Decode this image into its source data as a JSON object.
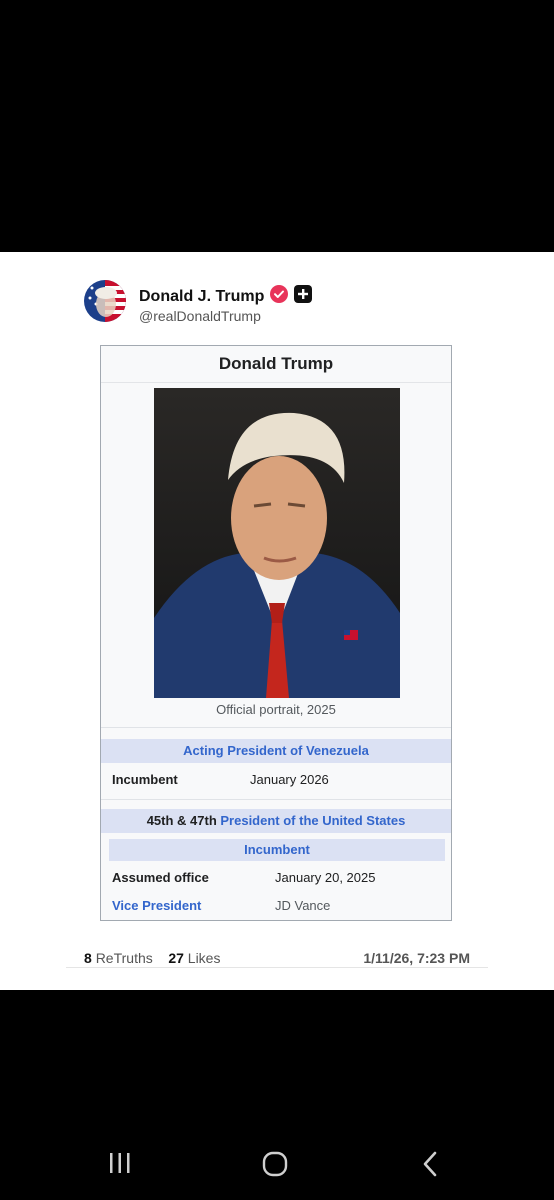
{
  "post": {
    "author_name": "Donald J. Trump",
    "author_handle": "@realDonaldTrump",
    "retruths_count": "8",
    "retruths_label": "ReTruths",
    "likes_count": "27",
    "likes_label": "Likes",
    "timestamp": "1/11/26, 7:23 PM"
  },
  "infobox": {
    "title": "Donald Trump",
    "caption": "Official portrait, 2025",
    "section1": {
      "header_prefix": "Acting ",
      "header_link": "President of Venezuela",
      "row_label": "Incumbent",
      "row_value": "January 2026"
    },
    "section2": {
      "header_prefix": "45th & 47th ",
      "header_link": "President of the United States",
      "sub_header": "Incumbent",
      "rows": [
        {
          "label": "Assumed office",
          "value": "January 20, 2025"
        },
        {
          "label": "Vice President",
          "value": "JD Vance"
        }
      ]
    }
  },
  "colors": {
    "verified": "#e8345a",
    "link": "#3366cc",
    "header_bg": "#dbe1f3"
  },
  "system_nav": {
    "recent_apps": "recent-apps-icon",
    "home": "home-icon",
    "back": "back-icon"
  }
}
